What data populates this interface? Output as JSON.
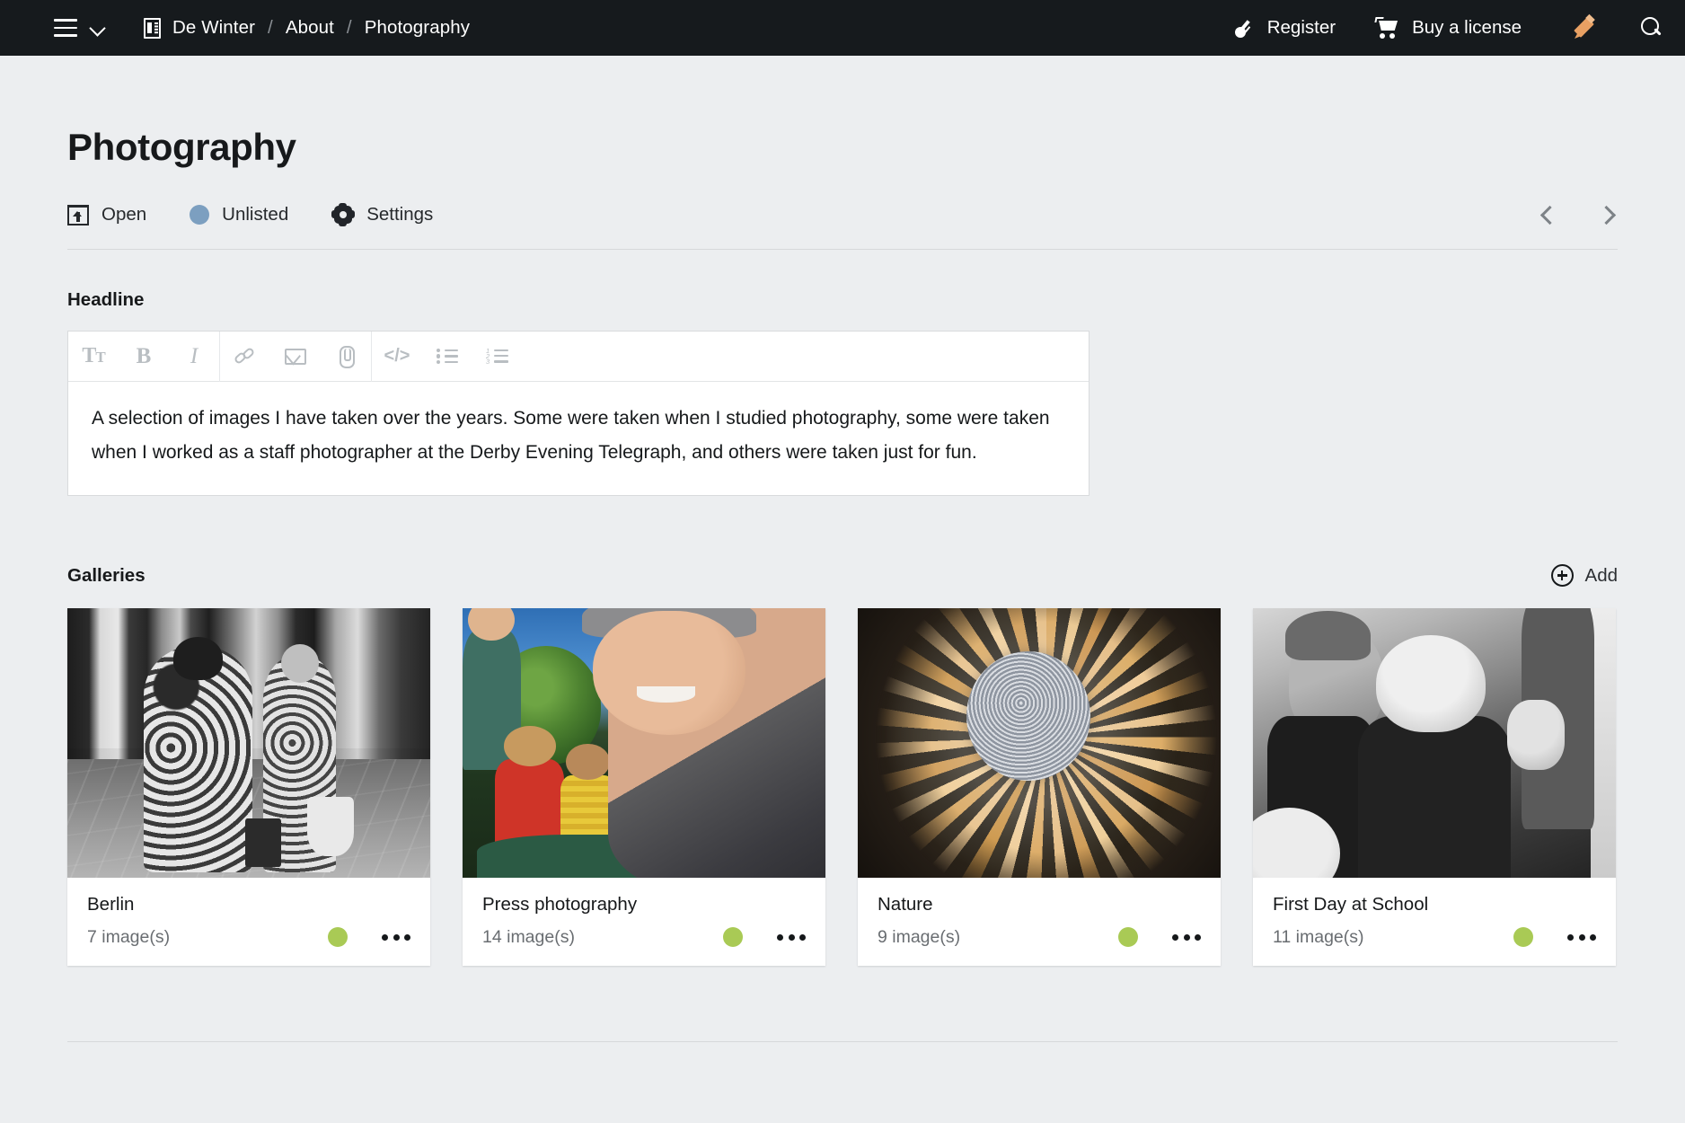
{
  "topbar": {
    "menu_icon": "hamburger-icon",
    "menu_caret": "chevron-down-icon",
    "doc_icon": "document-icon",
    "breadcrumbs": [
      {
        "label": "De Winter"
      },
      {
        "label": "About"
      },
      {
        "label": "Photography"
      }
    ],
    "separator": "/",
    "register": {
      "label": "Register",
      "icon": "key-icon"
    },
    "buy_license": {
      "label": "Buy a license",
      "icon": "cart-icon"
    },
    "edit": {
      "icon": "pencil-icon",
      "color": "#e8a063"
    },
    "search": {
      "icon": "search-icon"
    },
    "background": "#161a1d"
  },
  "page": {
    "title": "Photography"
  },
  "status": {
    "open": {
      "label": "Open",
      "icon": "open-in-icon"
    },
    "visibility": {
      "label": "Unlisted",
      "icon": "status-dot",
      "color": "#7c9fc0"
    },
    "settings": {
      "label": "Settings",
      "icon": "gear-icon"
    },
    "prev": {
      "icon": "chevron-left-icon"
    },
    "next": {
      "icon": "chevron-right-icon"
    }
  },
  "headline": {
    "label": "Headline",
    "toolbar": [
      {
        "name": "text-style",
        "glyph": "Tt"
      },
      {
        "name": "bold",
        "glyph": "B"
      },
      {
        "name": "italic",
        "glyph": "I"
      },
      {
        "name": "link",
        "glyph": "link-icon"
      },
      {
        "name": "email",
        "glyph": "mail-icon"
      },
      {
        "name": "attachment",
        "glyph": "paperclip-icon"
      },
      {
        "name": "code",
        "glyph": "</>"
      },
      {
        "name": "bulleted-list",
        "glyph": "ul-icon"
      },
      {
        "name": "numbered-list",
        "glyph": "ol-icon"
      }
    ],
    "body": "A selection of images I have taken over the years. Some were taken when I studied photography, some were taken when I worked as a staff photographer at the Derby Evening Telegraph, and others were taken just for fun."
  },
  "galleries": {
    "label": "Galleries",
    "add_label": "Add",
    "add_icon": "plus-circle-icon",
    "status_color": "#a9ca55",
    "more_icon": "ellipsis-icon",
    "cards": [
      {
        "title": "Berlin",
        "count": "7 image(s)",
        "thumb": "black-and-white-train-station-photo"
      },
      {
        "title": "Press photography",
        "count": "14 image(s)",
        "thumb": "colour-portrait-man-and-children-photo"
      },
      {
        "title": "Nature",
        "count": "9 image(s)",
        "thumb": "frosted-flower-macro-photo"
      },
      {
        "title": "First Day at School",
        "count": "11 image(s)",
        "thumb": "black-and-white-children-photo"
      }
    ]
  }
}
